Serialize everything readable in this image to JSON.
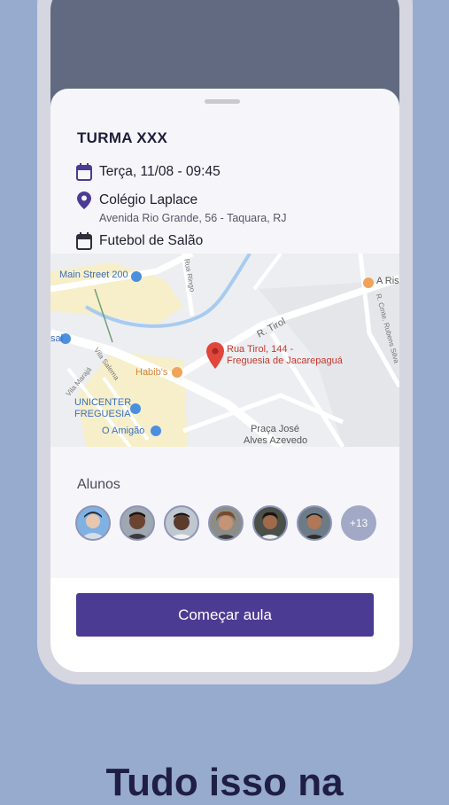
{
  "class": {
    "title": "TURMA XXX",
    "datetime": "Terça, 11/08 - 09:45",
    "location_name": "Colégio Laplace",
    "location_address": "Avenida Rio Grande, 56 - Taquara, RJ",
    "activity": "Futebol de Salão"
  },
  "map": {
    "pin_label_line1": "Rua Tirol, 144 -",
    "pin_label_line2": "Freguesia de Jacarepaguá",
    "labels": {
      "main_street": "Main Street 200",
      "rua_tirol": "R. Tirol",
      "habibs": "Habib's",
      "unicenter1": "UNICENTER",
      "unicenter2": "FREGUESIA",
      "o_amigao": "O Amigão",
      "praca1": "Praça José",
      "praca2": "Alves Azevedo",
      "a_ris": "A Ris",
      "vila_maraja": "Vila Marajá",
      "vila_salema": "Vila Salema",
      "rua_ringo": "Rua Ringo",
      "rua_rubens": "R. Cmte. Rubens Silva",
      "sai": "sai"
    },
    "colors": {
      "pin": "#e0463b",
      "water": "#a8cbf0",
      "park": "#f6efc9",
      "road": "#ffffff"
    }
  },
  "students": {
    "label": "Alunos",
    "more_count": "+13",
    "avatars": [
      {
        "name": "student-1",
        "skin": "#e8c7b0",
        "hair": "#2a2a36",
        "bg": "#7fb2e3"
      },
      {
        "name": "student-2",
        "skin": "#6a4431",
        "hair": "#1b120e",
        "bg": "#9fa7b2"
      },
      {
        "name": "student-3",
        "skin": "#5b3b2c",
        "hair": "#140d0a",
        "bg": "#bfc7d1"
      },
      {
        "name": "student-4",
        "skin": "#c69474",
        "hair": "#7a4a2a",
        "bg": "#8d8d88"
      },
      {
        "name": "student-5",
        "skin": "#a06a4b",
        "hair": "#1a1412",
        "bg": "#4a5048"
      },
      {
        "name": "student-6",
        "skin": "#b17756",
        "hair": "#1e1612",
        "bg": "#6d7b86"
      }
    ]
  },
  "action": {
    "start_label": "Começar aula"
  },
  "promo": {
    "headline": "Tudo isso na"
  },
  "colors": {
    "accent": "#4b3b93",
    "background": "#97abcf",
    "icon": "#4b3b93"
  }
}
